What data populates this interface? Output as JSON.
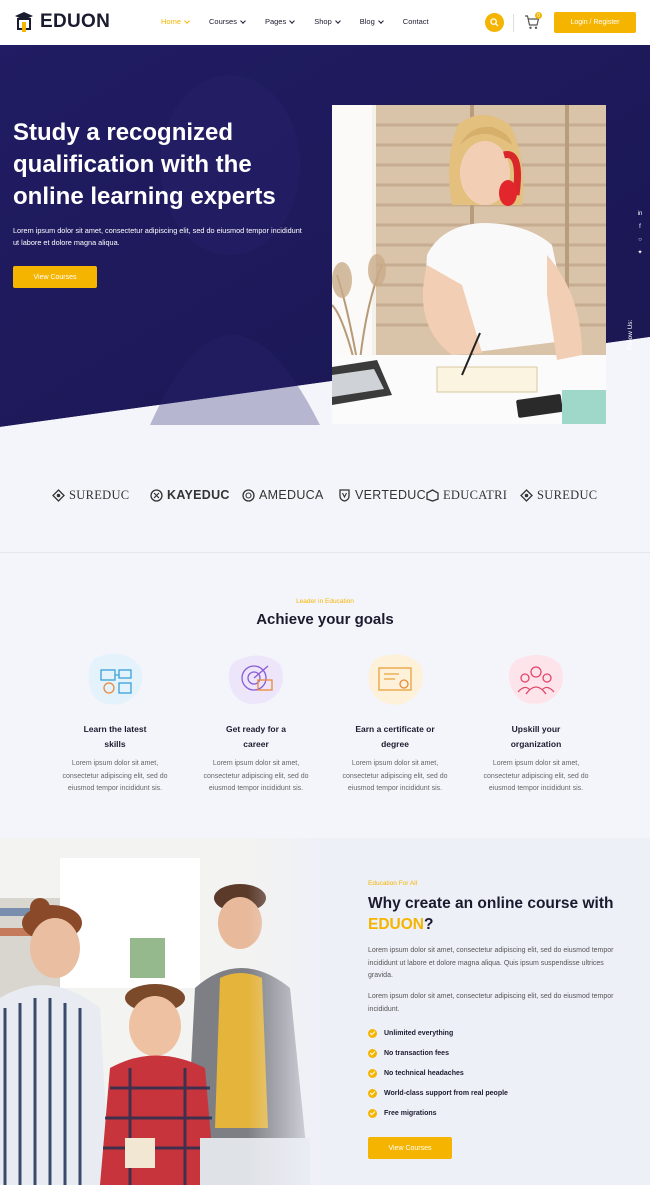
{
  "header": {
    "brand": "EDUON",
    "nav": [
      {
        "label": "Home",
        "active": true,
        "dropdown": true
      },
      {
        "label": "Courses",
        "active": false,
        "dropdown": true
      },
      {
        "label": "Pages",
        "active": false,
        "dropdown": true
      },
      {
        "label": "Shop",
        "active": false,
        "dropdown": true
      },
      {
        "label": "Blog",
        "active": false,
        "dropdown": true
      },
      {
        "label": "Contact",
        "active": false,
        "dropdown": false
      }
    ],
    "search_icon": "search-icon",
    "cart_icon": "cart-icon",
    "cart_count": "0",
    "login_label": "Login / Register"
  },
  "hero": {
    "title": "Study a recognized qualification with the online learning experts",
    "description": "Lorem ipsum dolor sit amet, consectetur adipiscing elit, sed do eiusmod tempor incididunt ut labore et dolore magna aliqua.",
    "button_label": "View Courses",
    "social": [
      "linkedin-icon",
      "facebook-icon",
      "instagram-icon",
      "twitter-icon"
    ],
    "follow_label": "Follow Us:"
  },
  "brands": [
    "SUREDUC",
    "KAYEDUC",
    "AMEDUCA",
    "VERTEDUC",
    "EDUCATRI",
    "SUREDUC"
  ],
  "goals": {
    "kicker": "Leader in Education",
    "title": "Achieve your goals",
    "items": [
      {
        "icon": "learning-icon",
        "title_1": "Learn the latest",
        "title_2": "skills",
        "desc_1": "Lorem ipsum dolor sit amet,",
        "desc_2": "consectetur adipiscing elit, sed do",
        "desc_3": "eiusmod tempor incididunt sis."
      },
      {
        "icon": "career-icon",
        "title_1": "Get ready for a",
        "title_2": "career",
        "desc_1": "Lorem ipsum dolor sit amet,",
        "desc_2": "consectetur adipiscing elit, sed do",
        "desc_3": "eiusmod tempor incididunt sis."
      },
      {
        "icon": "certificate-icon",
        "title_1": "Earn a certificate or",
        "title_2": "degree",
        "desc_1": "Lorem ipsum dolor sit amet,",
        "desc_2": "consectetur adipiscing elit, sed do",
        "desc_3": "eiusmod tempor incididunt sis."
      },
      {
        "icon": "organization-icon",
        "title_1": "Upskill your",
        "title_2": "organization",
        "desc_1": "Lorem ipsum dolor sit amet,",
        "desc_2": "consectetur adipiscing elit, sed do",
        "desc_3": "eiusmod tempor incididunt sis."
      }
    ]
  },
  "why": {
    "kicker": "Education For All",
    "title_prefix": "Why create an online course with ",
    "title_accent": "EDUON",
    "title_suffix": "?",
    "paragraph_1": "Lorem ipsum dolor sit amet, consectetur adipiscing elit, sed do eiusmod tempor incididunt ut labore et dolore magna aliqua. Quis ipsum suspendisse ultrices gravida.",
    "paragraph_2": "Lorem ipsum dolor sit amet, consectetur adipiscing elit, sed do eiusmod tempor incididunt.",
    "checklist": [
      "Unlimited everything",
      "No transaction fees",
      "No technical headaches",
      "World-class support from real people",
      "Free migrations"
    ],
    "button_label": "View Courses"
  },
  "colors": {
    "accent": "#f5b400",
    "hero_bg": "#1e1b5e",
    "dark": "#1b1b2f"
  }
}
